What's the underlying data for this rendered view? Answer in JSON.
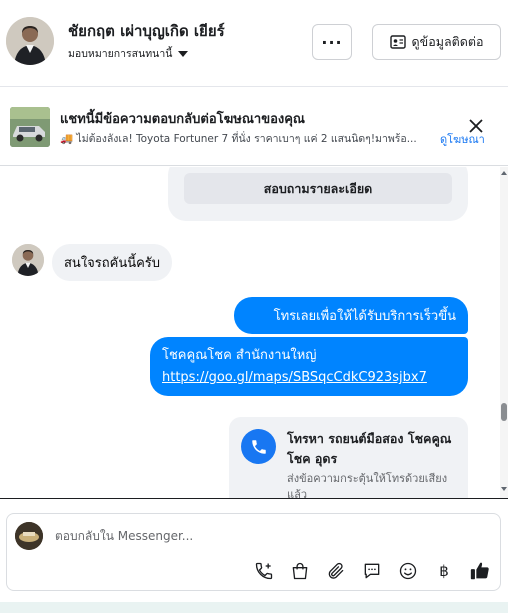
{
  "header": {
    "contact_name": "ชัยกฤต เผ่าบุญเกิด เยียร์",
    "assign_label": "มอบหมายการสนทนานี้",
    "more_label": "···",
    "info_button_label": "ดูข้อมูลติดต่อ"
  },
  "ad_banner": {
    "title": "แชทนี้มีข้อความตอบกลับต่อโฆษณาของคุณ",
    "subtitle": "🚚 ไม่ต้องลังเล! Toyota Fortuner 7 ที่นั่ง ราคาเบาๆ แค่ 2 แสนนิดๆ!มาพร้อ...",
    "link": "ดูโฆษณา"
  },
  "messages": {
    "card_button": "สอบถามรายละเอียด",
    "incoming_1": "สนใจรถคันนี้ครับ",
    "outgoing_1": "โทรเลยเพื่อให้ได้รับบริการเร็วขึ้น",
    "outgoing_2_line1": "โชคคูณโชค สำนักงานใหญ่",
    "outgoing_2_link": "https://goo.gl/maps/SBSqcCdkC923sjbx7",
    "call_card": {
      "title": "โทรหา รถยนต์มือสอง โชคคูณโชค อุดร",
      "subtitle": "ส่งข้อความกระตุ้นให้โทรด้วยเสียงแล้ว"
    }
  },
  "composer": {
    "placeholder": "ตอบกลับใน Messenger...",
    "tools": [
      "phone-plus-icon",
      "shopping-bag-icon",
      "paperclip-icon",
      "chat-bubble-icon",
      "emoji-icon",
      "baht-icon",
      "thumbs-up-icon"
    ],
    "baht_symbol": "฿"
  },
  "colors": {
    "accent": "#1877f2",
    "bubble_out": "#0084ff",
    "bubble_in": "#f0f2f5"
  }
}
